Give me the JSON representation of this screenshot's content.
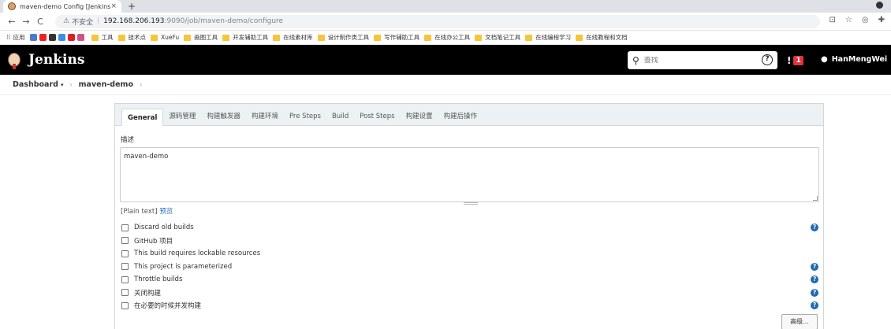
{
  "browser": {
    "tab_title": "maven-demo Config [Jenkins]",
    "tab_close": "×",
    "new_tab": "+",
    "back": "←",
    "forward": "→",
    "reload": "C",
    "insecure_label": "不安全",
    "url_host": "192.168.206.193",
    "url_path": ":9090/job/maven-demo/configure",
    "bookmarks": [
      "应用",
      "工具",
      "技术点",
      "XueFu",
      "画图工具",
      "开发辅助工具",
      "在线素材库",
      "设计制作类工具",
      "写作辅助工具",
      "在线办公工具",
      "文档笔记工具",
      "在线编程学习",
      "在线教程和文档"
    ]
  },
  "header": {
    "title": "Jenkins",
    "search_placeholder": "查找",
    "help": "?",
    "alert_count": "1",
    "user": "HanMengWei"
  },
  "breadcrumb": {
    "root": "Dashboard",
    "caret": "▾",
    "job": "maven-demo",
    "sep": "›"
  },
  "tabs": [
    "General",
    "源码管理",
    "构建触发器",
    "构建环境",
    "Pre Steps",
    "Build",
    "Post Steps",
    "构建设置",
    "构建后操作"
  ],
  "general": {
    "description_label": "描述",
    "description_value": "maven-demo",
    "plain_text": "[Plain text]",
    "preview": "预览",
    "options": [
      {
        "label": "Discard old builds",
        "help": true
      },
      {
        "label": "GitHub 项目",
        "help": false
      },
      {
        "label": "This build requires lockable resources",
        "help": false
      },
      {
        "label": "This project is parameterized",
        "help": true
      },
      {
        "label": "Throttle builds",
        "help": true
      },
      {
        "label": "关闭构建",
        "help": true
      },
      {
        "label": "在必要的时候并发构建",
        "help": true
      }
    ],
    "advanced_button": "高级..."
  },
  "colors": {
    "header_bg": "#000000",
    "link_blue": "#2a6ebb",
    "help_blue": "#1e6ab2",
    "alert_red": "#e5323b"
  }
}
